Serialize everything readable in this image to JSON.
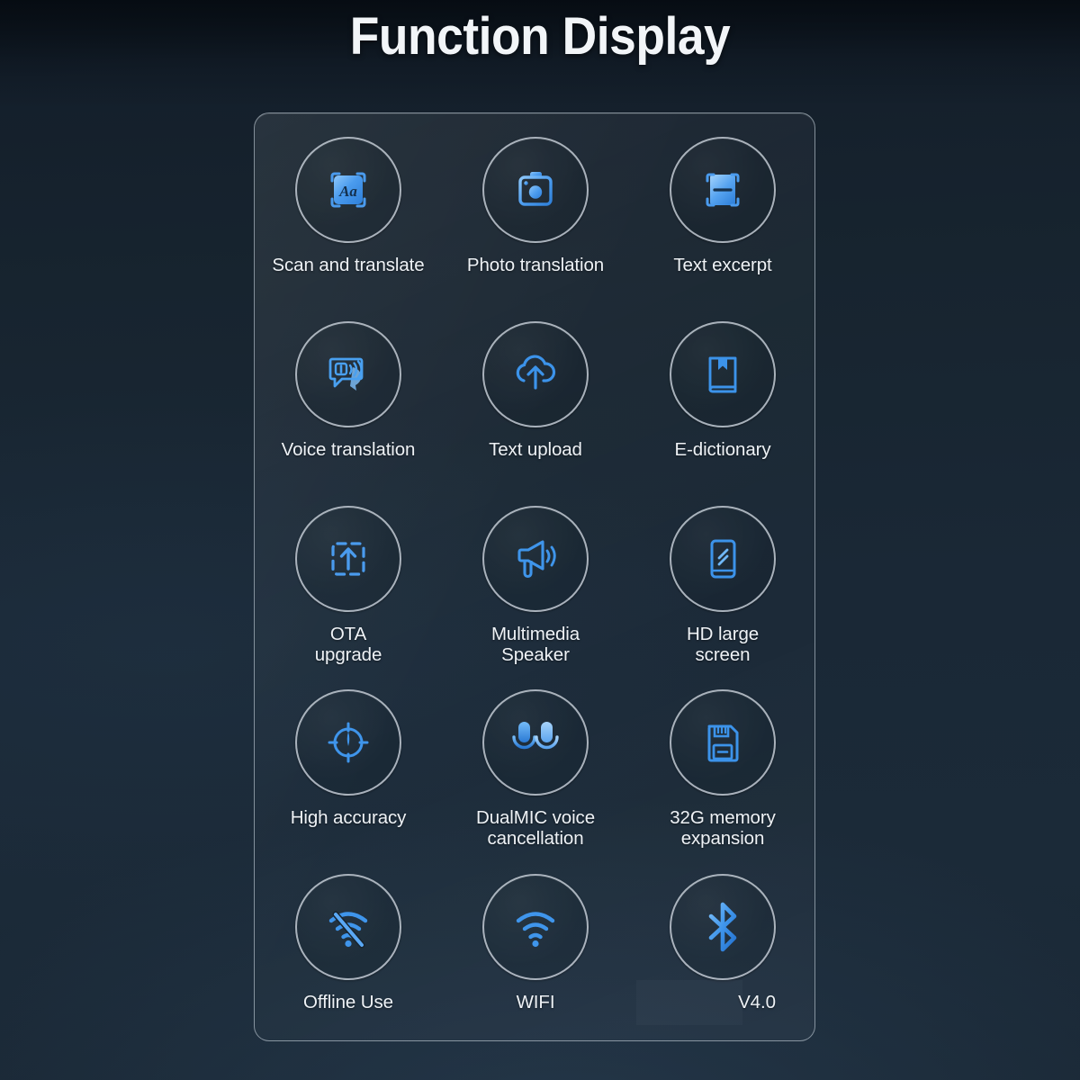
{
  "header": {
    "title": "Function Display"
  },
  "colors": {
    "background_top": "#0e1720",
    "background_bottom": "#1b2a38",
    "panel_border": "#c4ced8",
    "circle_ring": "#cdd5dd",
    "icon_blue": "#3d8fe8",
    "icon_blue_light": "#6fb7f7",
    "label_text": "#eef2f6",
    "title_text": "#f2f5f8"
  },
  "panel": {
    "features": [
      {
        "id": "scan-and-translate",
        "label": "Scan and translate",
        "icon": "scan-text-aa-icon"
      },
      {
        "id": "photo-translation",
        "label": "Photo translation",
        "icon": "camera-icon"
      },
      {
        "id": "text-excerpt",
        "label": "Text excerpt",
        "icon": "scan-excerpt-icon"
      },
      {
        "id": "voice-translation",
        "label": "Voice translation",
        "icon": "speech-bubbles-sound-icon"
      },
      {
        "id": "text-upload",
        "label": "Text upload",
        "icon": "cloud-upload-icon"
      },
      {
        "id": "e-dictionary",
        "label": "E-dictionary",
        "icon": "book-bookmark-icon"
      },
      {
        "id": "ota-upgrade",
        "label": "OTA\nupgrade",
        "icon": "dashed-box-upload-icon"
      },
      {
        "id": "multimedia-speaker",
        "label": "Multimedia\nSpeaker",
        "icon": "megaphone-icon"
      },
      {
        "id": "hd-large-screen",
        "label": "HD large\nscreen",
        "icon": "phone-screen-shine-icon"
      },
      {
        "id": "high-accuracy",
        "label": "High accuracy",
        "icon": "crosshair-target-icon"
      },
      {
        "id": "dualmic-noise",
        "label": "DualMIC voice\ncancellation",
        "icon": "dual-microphone-icon"
      },
      {
        "id": "memory-expansion",
        "label": "32G memory\nexpansion",
        "icon": "memory-card-icon"
      },
      {
        "id": "offline-use",
        "label": "Offline Use",
        "icon": "wifi-off-icon"
      },
      {
        "id": "wifi",
        "label": "WIFI",
        "icon": "wifi-icon"
      },
      {
        "id": "bluetooth-version",
        "label": "V4.0",
        "icon": "bluetooth-icon"
      }
    ]
  }
}
